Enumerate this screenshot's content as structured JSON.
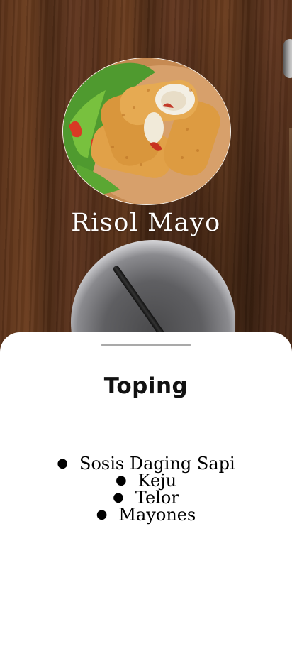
{
  "header": {
    "dish_name": "Risol Mayo"
  },
  "sheet": {
    "title": "Toping",
    "toppings": [
      "Sosis Daging Sapi",
      "Keju",
      "Telor",
      "Mayones"
    ]
  },
  "colors": {
    "sheet_background": "#ffffff",
    "title_text": "#ffffff",
    "handle": "#a9a9a9",
    "wood": "#5b3219"
  },
  "icons": {
    "list_bullet": "bullet-icon"
  }
}
